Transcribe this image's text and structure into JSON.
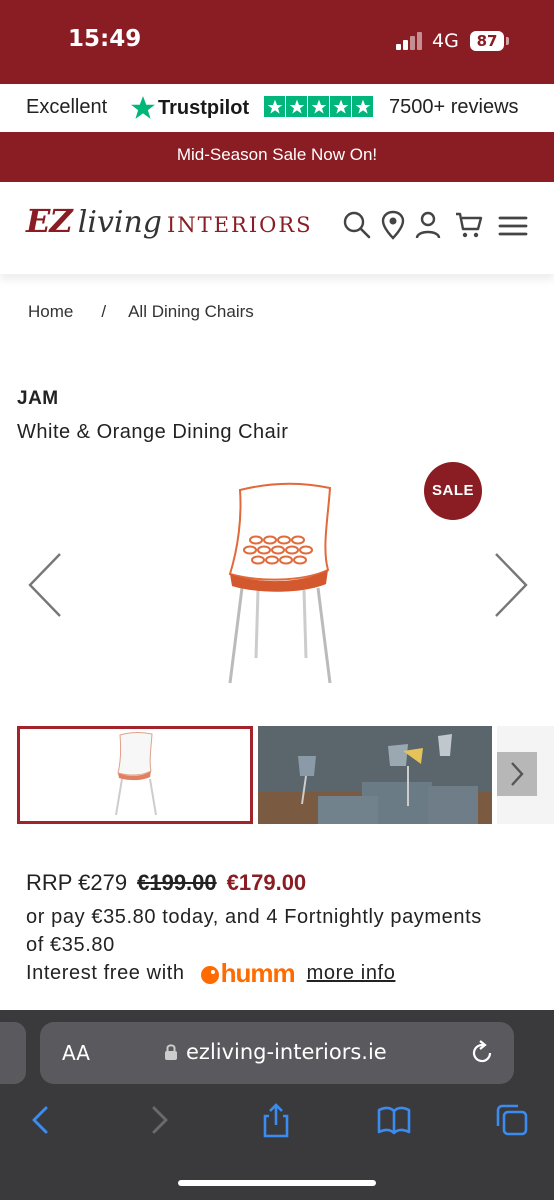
{
  "status_bar": {
    "time": "15:49",
    "network": "4G",
    "battery": "87"
  },
  "trustpilot": {
    "rating_text": "Excellent",
    "brand": "Trustpilot",
    "reviews": "7500+ reviews"
  },
  "banner": {
    "text": "Mid-Season Sale Now On!"
  },
  "header": {
    "logo": {
      "ez": "EZ",
      "living": "living",
      "interiors": "INTERIORS"
    },
    "icons": [
      "search-icon",
      "location-icon",
      "account-icon",
      "cart-icon",
      "menu-icon"
    ]
  },
  "breadcrumb": {
    "home": "Home",
    "separator": "/",
    "current": "All Dining Chairs"
  },
  "product": {
    "brand": "JAM",
    "name": "White & Orange Dining Chair",
    "sale_badge": "SALE",
    "price": {
      "rrp": "RRP €279",
      "was": "€199.00",
      "now": "€179.00"
    },
    "finance_text": "or pay €35.80 today, and 4 Fortnightly payments of €35.80",
    "interest_text": "Interest free with",
    "humm_logo": "humm",
    "more_info": "more info"
  },
  "browser": {
    "aa_label": "AA",
    "url": "ezliving-interiors.ie"
  },
  "colors": {
    "brand_red": "#8a1d23",
    "trustpilot_green": "#00b67a",
    "humm_orange": "#ff6b00"
  }
}
